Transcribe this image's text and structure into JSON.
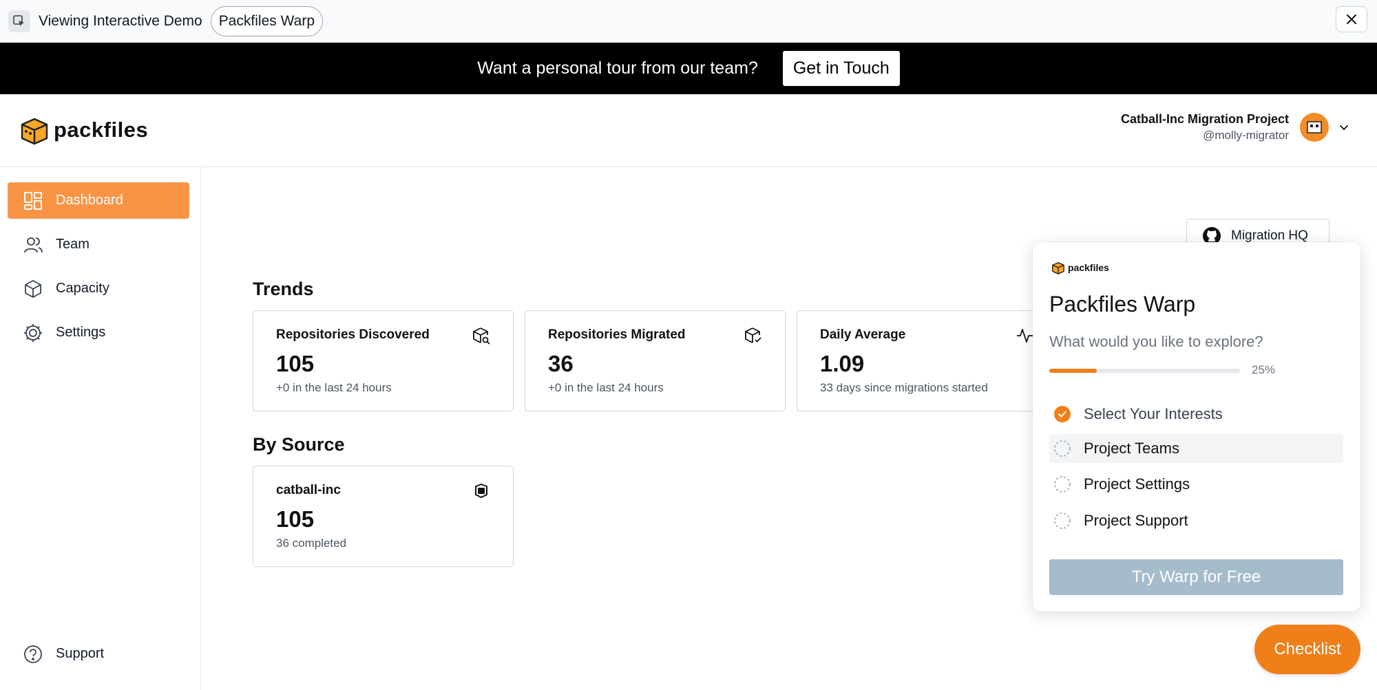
{
  "demo_bar": {
    "label": "Viewing Interactive Demo",
    "pill": "Packfiles Warp"
  },
  "promo": {
    "text": "Want a personal tour from our team?",
    "button": "Get in Touch"
  },
  "header": {
    "logo_text": "packfiles",
    "project_name": "Catball-Inc Migration Project",
    "handle": "@molly-migrator"
  },
  "sidebar": {
    "items": [
      {
        "label": "Dashboard",
        "icon": "dashboard-icon",
        "active": true
      },
      {
        "label": "Team",
        "icon": "team-icon"
      },
      {
        "label": "Capacity",
        "icon": "box-icon"
      },
      {
        "label": "Settings",
        "icon": "gear-icon"
      }
    ],
    "support": {
      "label": "Support",
      "icon": "help-icon"
    }
  },
  "main": {
    "migration_hq": "Migration HQ",
    "trends_title": "Trends",
    "by_source_title": "By Source",
    "trends": [
      {
        "title": "Repositories Discovered",
        "value": "105",
        "sub": "+0 in the last 24 hours",
        "icon": "package-search-icon"
      },
      {
        "title": "Repositories Migrated",
        "value": "36",
        "sub": "+0 in the last 24 hours",
        "icon": "package-check-icon"
      },
      {
        "title": "Daily Average",
        "value": "1.09",
        "sub": "33 days since migrations started",
        "icon": "activity-icon"
      }
    ],
    "sources": [
      {
        "title": "catball-inc",
        "value": "105",
        "sub": "36 completed",
        "icon": "source-org-icon"
      }
    ]
  },
  "popup": {
    "logo_text": "packfiles",
    "title": "Packfiles Warp",
    "subtitle": "What would you like to explore?",
    "progress": 25,
    "progress_label": "25%",
    "steps": [
      {
        "label": "Select Your Interests",
        "done": true
      },
      {
        "label": "Project Teams",
        "done": false
      },
      {
        "label": "Project Settings",
        "done": false
      },
      {
        "label": "Project Support",
        "done": false
      }
    ],
    "cta": "Try Warp for Free"
  },
  "checklist_button": "Checklist",
  "colors": {
    "accent": "#f99446",
    "accent_strong": "#f07f19",
    "cta_disabled": "#a5bccd"
  }
}
